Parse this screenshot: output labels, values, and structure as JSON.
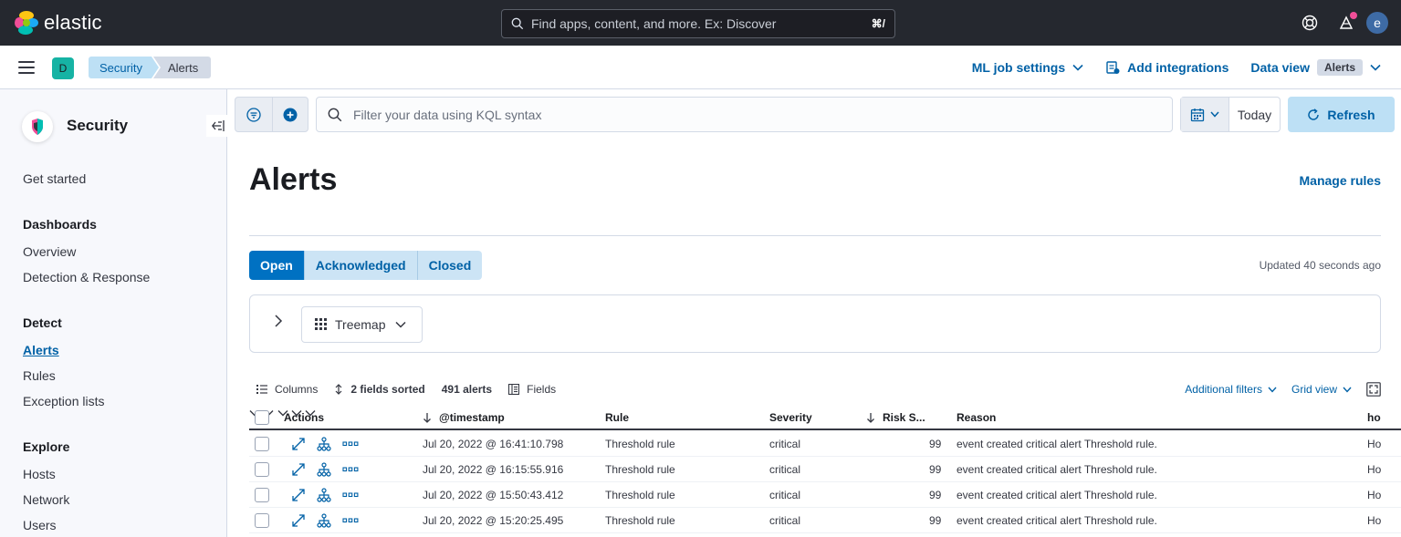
{
  "app": {
    "brand": "elastic",
    "search_placeholder": "Find apps, content, and more. Ex: Discover",
    "search_shortcut": "⌘/",
    "user_initial": "e",
    "space_initial": "D"
  },
  "breadcrumbs": [
    "Security",
    "Alerts"
  ],
  "header_links": {
    "ml_job_settings": "ML job settings",
    "add_integrations": "Add integrations",
    "data_view": "Data view",
    "data_view_value": "Alerts"
  },
  "sidebar": {
    "title": "Security",
    "get_started": "Get started",
    "sections": [
      {
        "heading": "Dashboards",
        "items": [
          "Overview",
          "Detection & Response"
        ]
      },
      {
        "heading": "Detect",
        "items": [
          "Alerts",
          "Rules",
          "Exception lists"
        ]
      },
      {
        "heading": "Explore",
        "items": [
          "Hosts",
          "Network",
          "Users"
        ]
      }
    ]
  },
  "query_bar": {
    "placeholder": "Filter your data using KQL syntax",
    "date": "Today",
    "refresh": "Refresh"
  },
  "page": {
    "title": "Alerts",
    "manage_rules": "Manage rules",
    "tabs": [
      "Open",
      "Acknowledged",
      "Closed"
    ],
    "active_tab": "Open",
    "updated": "Updated 40 seconds ago",
    "group_by": "Treemap"
  },
  "grid_toolbar": {
    "columns": "Columns",
    "sorted": "2 fields sorted",
    "count": "491 alerts",
    "fields": "Fields",
    "additional_filters": "Additional filters",
    "grid_view": "Grid view"
  },
  "table": {
    "headers": {
      "actions": "Actions",
      "timestamp": "@timestamp",
      "rule": "Rule",
      "severity": "Severity",
      "risk": "Risk S...",
      "reason": "Reason",
      "host": "ho"
    },
    "rows": [
      {
        "timestamp": "Jul 20, 2022 @ 16:41:10.798",
        "rule": "Threshold rule",
        "severity": "critical",
        "risk": "99",
        "reason": "event created critical alert Threshold rule.",
        "host": "Ho"
      },
      {
        "timestamp": "Jul 20, 2022 @ 16:15:55.916",
        "rule": "Threshold rule",
        "severity": "critical",
        "risk": "99",
        "reason": "event created critical alert Threshold rule.",
        "host": "Ho"
      },
      {
        "timestamp": "Jul 20, 2022 @ 15:50:43.412",
        "rule": "Threshold rule",
        "severity": "critical",
        "risk": "99",
        "reason": "event created critical alert Threshold rule.",
        "host": "Ho"
      },
      {
        "timestamp": "Jul 20, 2022 @ 15:20:25.495",
        "rule": "Threshold rule",
        "severity": "critical",
        "risk": "99",
        "reason": "event created critical alert Threshold rule.",
        "host": "Ho"
      }
    ]
  }
}
